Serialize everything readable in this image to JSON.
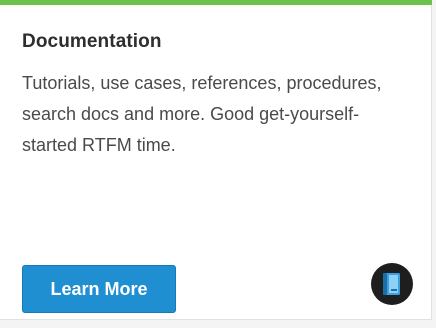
{
  "card": {
    "title": "Documentation",
    "description": "Tutorials, use cases, references, procedures, search docs and more. Good get-yourself-started RTFM time.",
    "button_label": "Learn More",
    "icon": "book-icon",
    "colors": {
      "accent": "#6cc24a",
      "button": "#1f8fd2",
      "icon_background": "#1e1e1e"
    }
  }
}
